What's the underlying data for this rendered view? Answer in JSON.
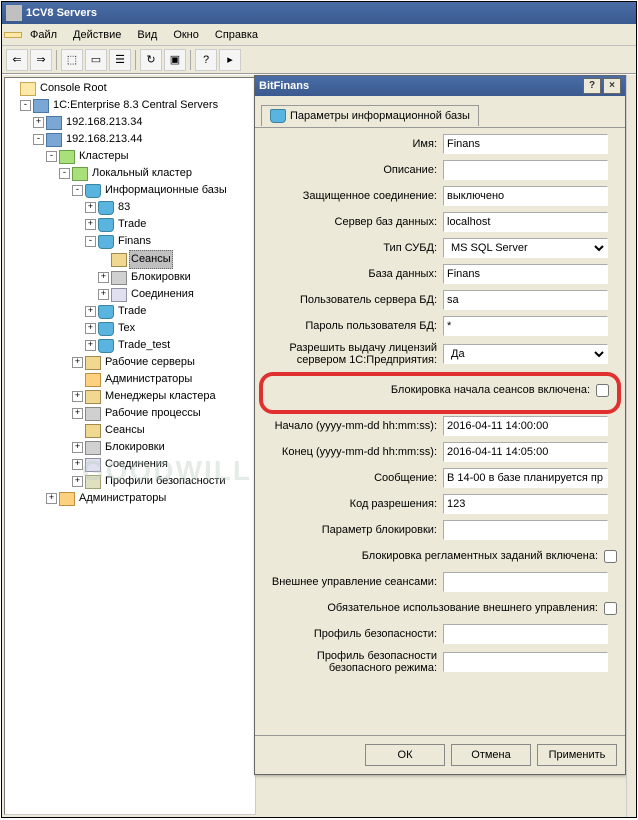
{
  "window": {
    "title": "1CV8 Servers"
  },
  "menu": {
    "file": "Файл",
    "action": "Действие",
    "view": "Вид",
    "window": "Окно",
    "help": "Справка"
  },
  "tree": {
    "root": "Console Root",
    "enterprise": "1C:Enterprise 8.3 Central Servers",
    "srv1": "192.168.213.34",
    "srv2": "192.168.213.44",
    "clusters": "Кластеры",
    "localCluster": "Локальный кластер",
    "infobases": "Информационные базы",
    "ib83": "83",
    "ibTrade": "Trade",
    "ibFinans": "Finans",
    "sessions": "Сеансы",
    "locks": "Блокировки",
    "connections": "Соединения",
    "ibTrade2": "Trade",
    "ibTex": "Tex",
    "ibTradeTest": "Trade_test",
    "workServers": "Рабочие серверы",
    "admins": "Администраторы",
    "clusterManagers": "Менеджеры кластера",
    "workProcesses": "Рабочие процессы",
    "sessions2": "Сеансы",
    "locks2": "Блокировки",
    "connections2": "Соединения",
    "securityProfiles": "Профили безопасности",
    "admins2": "Администраторы"
  },
  "dialog": {
    "title": "BitFinans",
    "tab": "Параметры информационной базы",
    "fields": {
      "name_lbl": "Имя:",
      "name": "Finans",
      "desc_lbl": "Описание:",
      "desc": "",
      "secure_lbl": "Защищенное соединение:",
      "secure": "выключено",
      "dbserver_lbl": "Сервер баз данных:",
      "dbserver": "localhost",
      "dbtype_lbl": "Тип СУБД:",
      "dbtype": "MS SQL Server",
      "dbname_lbl": "База данных:",
      "dbname": "Finans",
      "dbuser_lbl": "Пользователь сервера БД:",
      "dbuser": "sa",
      "dbpass_lbl": "Пароль пользователя БД:",
      "dbpass": "*",
      "license_lbl": "Разрешить выдачу лицензий сервером 1С:Предприятия:",
      "license": "Да",
      "lockstart_lbl": "Блокировка начала сеансов включена:",
      "start_lbl": "Начало (yyyy-mm-dd hh:mm:ss):",
      "start": "2016-04-11 14:00:00",
      "end_lbl": "Конец (yyyy-mm-dd hh:mm:ss):",
      "end": "2016-04-11 14:05:00",
      "msg_lbl": "Сообщение:",
      "msg": "В 14-00 в базе планируется пр",
      "permcode_lbl": "Код разрешения:",
      "permcode": "123",
      "lockparam_lbl": "Параметр блокировки:",
      "lockparam": "",
      "schedlock_lbl": "Блокировка регламентных заданий включена:",
      "extmanage_lbl": "Внешнее управление сеансами:",
      "extmanage": "",
      "extmanage_req_lbl": "Обязательное использование внешнего управления:",
      "secprofile_lbl": "Профиль безопасности:",
      "secprofile": "",
      "safesecprofile_lbl": "Профиль безопасности безопасного режима:",
      "safesecprofile": ""
    },
    "buttons": {
      "ok": "ОК",
      "cancel": "Отмена",
      "apply": "Применить"
    }
  },
  "watermark": "GOODWILL"
}
